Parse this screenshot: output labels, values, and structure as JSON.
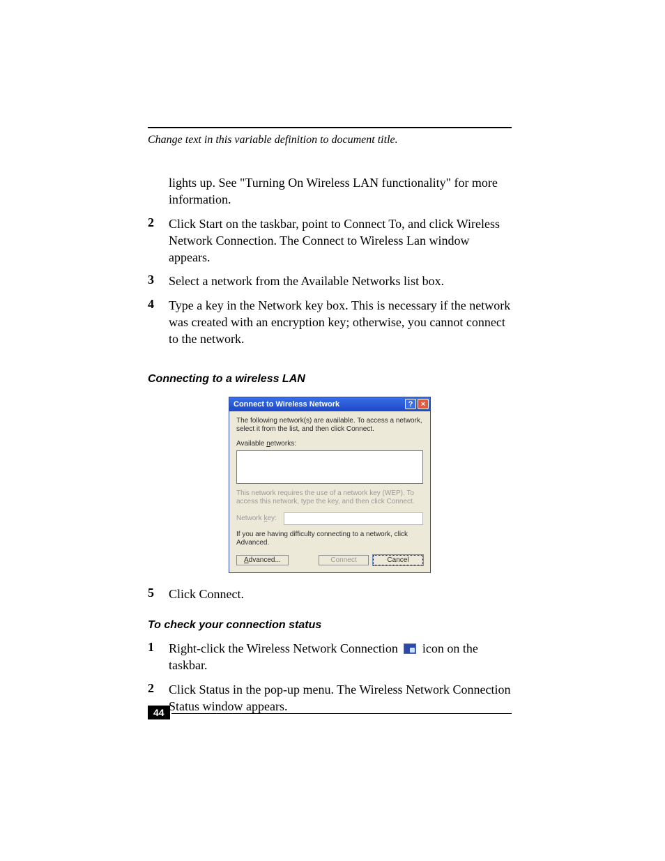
{
  "running_head": "Change text in this variable definition to document title.",
  "lead_paragraph": "lights up. See \"Turning On Wireless LAN functionality\" for more information.",
  "steps_a": [
    {
      "num": "2",
      "text": "Click Start on the taskbar, point to Connect To, and click Wireless Network Connection. The Connect to Wireless Lan window appears."
    },
    {
      "num": "3",
      "text": "Select a network from the Available Networks list box."
    },
    {
      "num": "4",
      "text": "Type a key in the Network key box. This is necessary if the network was created with an encryption key; otherwise, you cannot connect to the network."
    }
  ],
  "figure_caption": "Connecting to a wireless LAN",
  "dialog": {
    "title": "Connect to Wireless Network",
    "intro": "The following network(s) are available. To access a network, select it from the list, and then click Connect.",
    "available_label": "Available networks:",
    "wep_note": "This network requires the use of a network key (WEP). To access this network, type the key, and then click Connect.",
    "key_label": "Network key:",
    "advanced_note": "If you are having difficulty connecting to a network, click Advanced.",
    "buttons": {
      "advanced": "Advanced...",
      "connect": "Connect",
      "cancel": "Cancel"
    }
  },
  "step5": {
    "num": "5",
    "text": "Click Connect."
  },
  "subhead_b": "To check your connection status",
  "steps_b": [
    {
      "num": "1",
      "pre": "Right-click the Wireless Network Connection ",
      "post": " icon on the taskbar."
    },
    {
      "num": "2",
      "text": "Click Status in the pop-up menu. The Wireless Network Connection Status window appears."
    }
  ],
  "page_number": "44"
}
